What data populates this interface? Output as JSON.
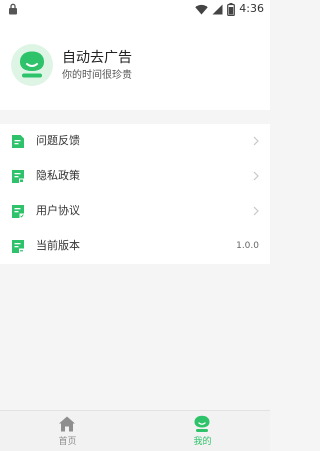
{
  "status_bar": {
    "time": "4:36",
    "icons": [
      "lock-icon",
      "wifi-icon",
      "signal-icon",
      "battery-icon"
    ]
  },
  "profile": {
    "app_name": "自动去广告",
    "slogan": "你的时间很珍贵",
    "avatar_icon": "smiley-avatar-icon"
  },
  "menu": {
    "items": [
      {
        "label": "问题反馈",
        "icon": "feedback-doc-icon",
        "trailing": "chevron"
      },
      {
        "label": "隐私政策",
        "icon": "privacy-doc-icon",
        "trailing": "chevron"
      },
      {
        "label": "用户协议",
        "icon": "agreement-doc-icon",
        "trailing": "chevron"
      },
      {
        "label": "当前版本",
        "icon": "version-doc-icon",
        "trailing_value": "1.0.0"
      }
    ]
  },
  "tabs": [
    {
      "label": "首页",
      "icon": "home-icon",
      "active": false
    },
    {
      "label": "我的",
      "icon": "profile-icon",
      "active": true
    }
  ],
  "colors": {
    "accent": "#2ec36a",
    "avatar_bg": "#def5e6",
    "inactive_tab": "#8e8e8e",
    "chevron": "#c8c8c8"
  }
}
